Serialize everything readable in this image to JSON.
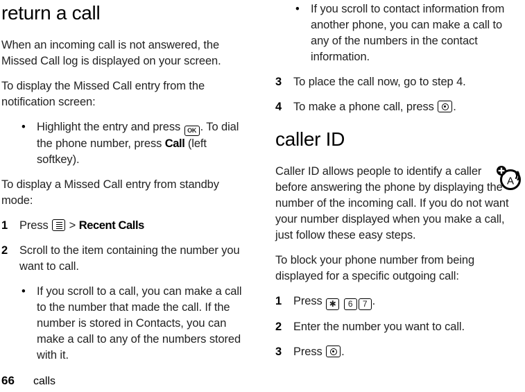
{
  "document": {
    "footer": {
      "page_number": "66",
      "chapter": "calls"
    }
  },
  "left_column": {
    "heading": "return a call",
    "paragraph_1": "When an incoming call is not answered, the Missed Call log is displayed on your screen.",
    "paragraph_2": "To display the Missed Call entry from the notification screen:",
    "bullet_1": {
      "text_before_key": "Highlight the entry and press",
      "key_icon": "ok-key-icon",
      "key_label": "OK",
      "text_after_key": ". To dial the phone number, press",
      "emphasis": "Call",
      "text_end": "(left softkey)."
    },
    "paragraph_3": "To display a Missed Call entry from standby mode:",
    "step_1": {
      "number": "1",
      "text_before_key": "Press",
      "key_icon": "menu-key-icon",
      "separator": ">",
      "menu_path": "Recent Calls"
    },
    "step_2": {
      "number": "2",
      "text": "Scroll to the item containing the number you want to call."
    },
    "bullet_2": "If you scroll to a call, you can make a call to the number that made the call. If the number is stored in Contacts, you can make a call to any of the numbers stored with it."
  },
  "right_column": {
    "bullet_1": "If you scroll to contact information from another phone, you can make a call to any of the numbers in the contact information.",
    "step_3": {
      "number": "3",
      "text": "To place the call now, go to step 4."
    },
    "step_4": {
      "number": "4",
      "text_before_key": "To make a phone call, press",
      "key_icon": "send-key-icon",
      "text_after_key": "."
    },
    "heading": "caller ID",
    "paragraph_1": "Caller ID allows people to identify a caller before answering the phone by displaying the number of the incoming call. If you do not want your number displayed when you make a call, just follow these easy steps.",
    "paragraph_2": "To block your phone number from being displayed for a specific outgoing call:",
    "step_b1": {
      "number": "1",
      "text_before_keys": "Press",
      "keys": [
        "✱",
        "6",
        "7"
      ],
      "text_after_keys": "."
    },
    "step_b2": {
      "number": "2",
      "text": "Enter the number you want to call."
    },
    "step_b3": {
      "number": "3",
      "text_before_key": "Press",
      "key_icon": "send-key-icon",
      "text_after_key": "."
    },
    "margin_icon": "caller-id-antenna-icon"
  }
}
